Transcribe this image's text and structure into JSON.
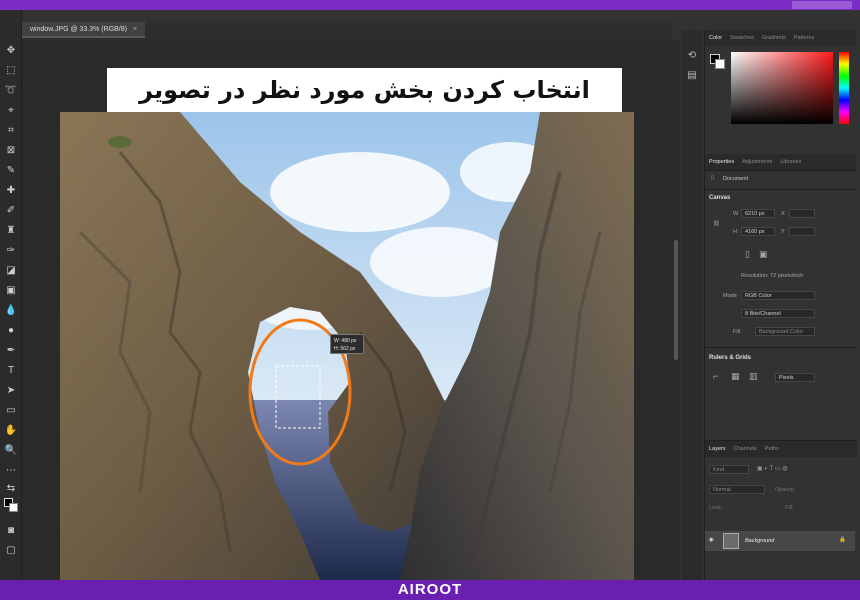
{
  "frame": {
    "top_labels": [
      "",
      ""
    ]
  },
  "document": {
    "tab_title": "window.JPG @ 33.3% (RGB/8)",
    "tab_close": "×"
  },
  "overlay": {
    "title": "انتخاب کردن بخش مورد نظر در تصویر"
  },
  "selection": {
    "width_label": "W: 480 px",
    "height_label": "H: 562 px"
  },
  "panels": {
    "color_tabs": [
      "Color",
      "Swatches",
      "Gradients",
      "Patterns"
    ],
    "properties_tabs": [
      "Properties",
      "Adjustments",
      "Libraries"
    ],
    "document_label": "Document",
    "canvas_header": "Canvas",
    "w_label": "W",
    "w_value": "6210 px",
    "h_label": "H",
    "h_value": "4160 px",
    "x_label": "X",
    "y_label": "Y",
    "resolution": "Resolution: 72 pixels/inch",
    "mode_label": "Mode",
    "mode_value": "RGB Color",
    "bit_value": "8 Bits/Channel",
    "fill_label": "Fill",
    "fill_value": "Background Color",
    "rulers_header": "Rulers & Grids",
    "units_value": "Pixels",
    "layers_tabs": [
      "Layers",
      "Channels",
      "Paths"
    ],
    "kind_label": "Kind",
    "blend_mode": "Normal",
    "opacity_label": "Opacity:",
    "lock_label": "Lock:",
    "fill2_label": "Fill:",
    "layer_name": "Background"
  },
  "footer": {
    "brand": "AIROOT"
  },
  "colors": {
    "frame": "#6a1fb0",
    "app_bg": "#323232",
    "selection_circle": "#f07a1a"
  }
}
